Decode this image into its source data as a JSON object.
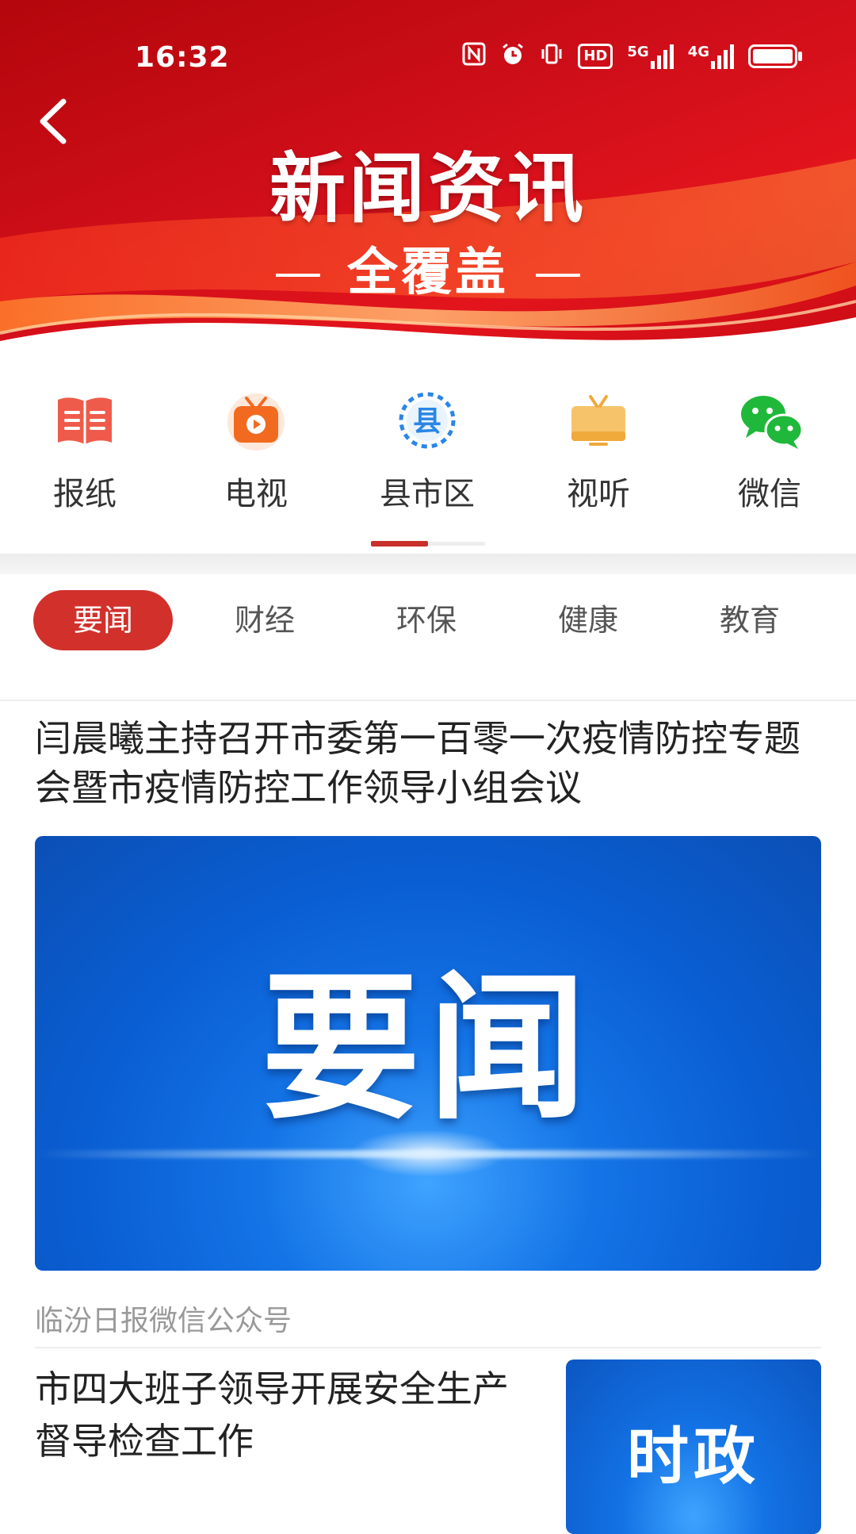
{
  "status_bar": {
    "time": "16:32",
    "icons": [
      "nfc-icon",
      "alarm-icon",
      "vibrate-icon",
      "hd-icon",
      "5g-signal-icon",
      "4g-signal-icon",
      "battery-icon"
    ],
    "hd_label": "HD",
    "net1_label": "5G",
    "net2_label": "4G"
  },
  "header": {
    "title": "新闻资讯",
    "subtitle": "全覆盖",
    "brand_color": "#d10f1a"
  },
  "categories": [
    {
      "label": "报纸",
      "icon": "newspaper-icon"
    },
    {
      "label": "电视",
      "icon": "tv-icon"
    },
    {
      "label": "县市区",
      "icon": "county-icon",
      "icon_text": "县",
      "selected": true
    },
    {
      "label": "视听",
      "icon": "audio-visual-icon"
    },
    {
      "label": "微信",
      "icon": "wechat-icon"
    }
  ],
  "subtabs": [
    {
      "label": "要闻",
      "active": true
    },
    {
      "label": "财经"
    },
    {
      "label": "环保"
    },
    {
      "label": "健康"
    },
    {
      "label": "教育"
    }
  ],
  "articles": [
    {
      "title": "闫晨曦主持召开市委第一百零一次疫情防控专题会暨市疫情防控工作领导小组会议",
      "image_text": "要闻",
      "source": "临汾日报微信公众号"
    },
    {
      "title": "市四大班子领导开展安全生产督导检查工作",
      "image_text": "时政"
    }
  ],
  "colors": {
    "accent_red": "#d2302b",
    "image_blue": "#1474e6"
  }
}
